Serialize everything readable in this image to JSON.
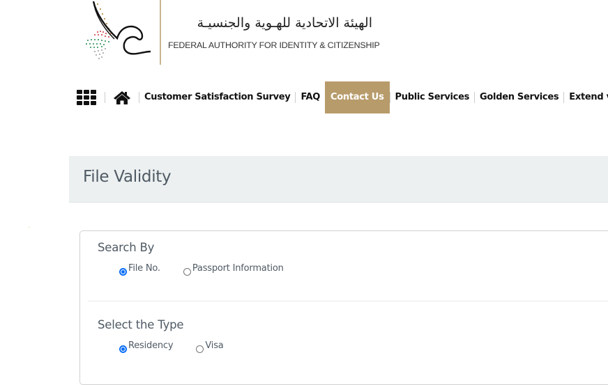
{
  "header": {
    "logo_arabic": "الهيئة الاتحادية للهـوية والجنسيـة",
    "logo_english": "FEDERAL AUTHORITY FOR IDENTITY & CITIZENSHIP"
  },
  "nav": {
    "menu_icon": "grid-menu-icon",
    "home_icon": "home-icon",
    "items": [
      {
        "label": "Customer Satisfaction Survey",
        "active": false
      },
      {
        "label": "FAQ",
        "active": false
      },
      {
        "label": "Contact Us",
        "active": true
      },
      {
        "label": "Public Services",
        "active": false
      },
      {
        "label": "Golden Services",
        "active": false
      },
      {
        "label": "Extend visa",
        "active": false
      }
    ],
    "active_color": "#b89b6b"
  },
  "page": {
    "title": "File Validity"
  },
  "form": {
    "search_by": {
      "label": "Search By",
      "options": [
        {
          "label": "File No.",
          "checked": true
        },
        {
          "label": "Passport Information",
          "checked": false
        }
      ]
    },
    "type": {
      "label": "Select the Type",
      "options": [
        {
          "label": "Residency",
          "checked": true
        },
        {
          "label": "Visa",
          "checked": false
        }
      ]
    }
  }
}
